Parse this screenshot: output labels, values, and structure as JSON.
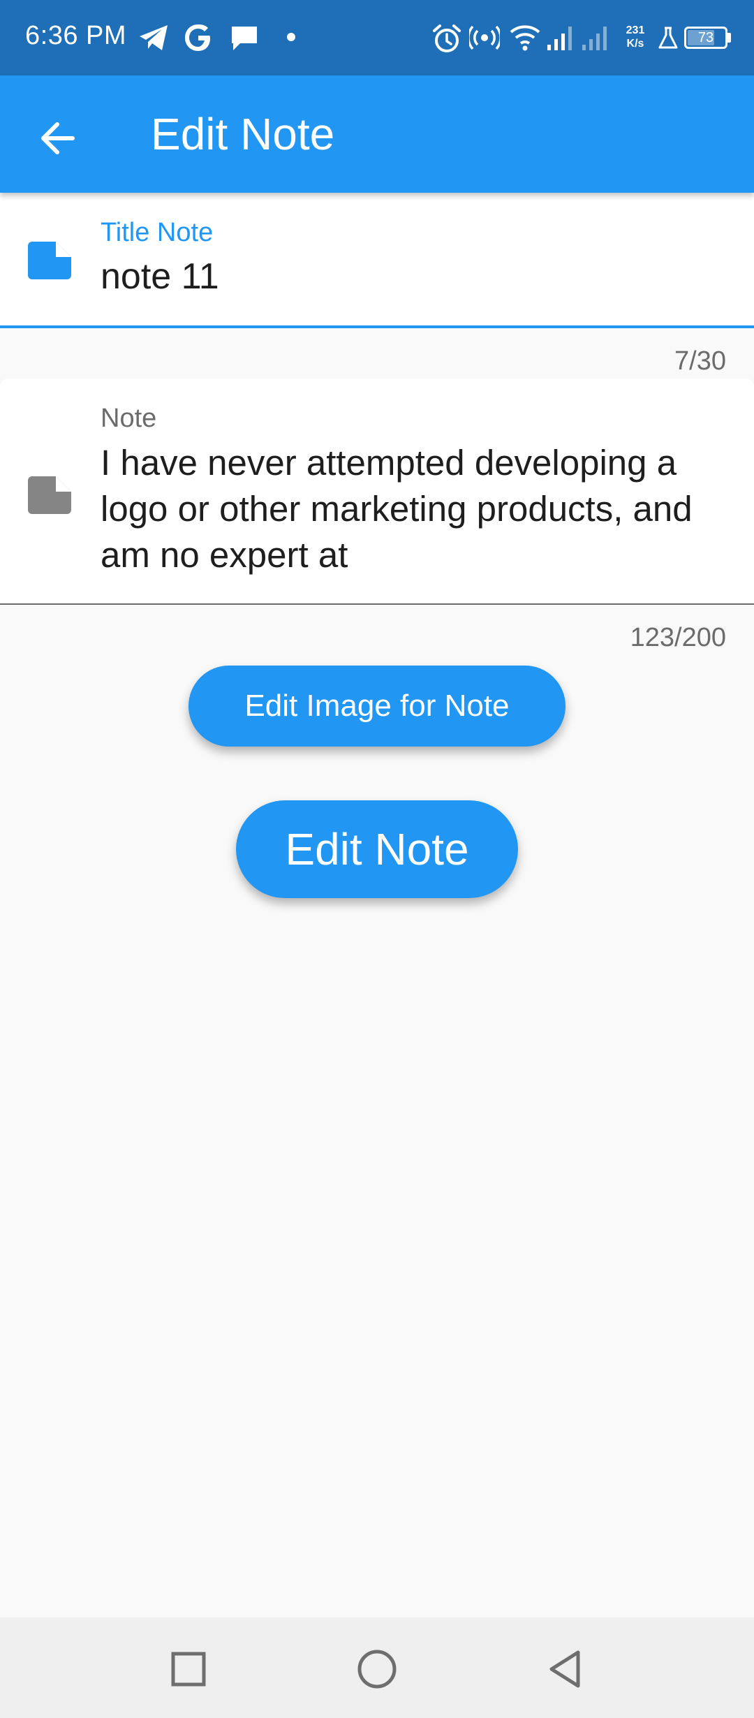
{
  "status_bar": {
    "time": "6:36 PM",
    "speed_value": "231",
    "speed_unit": "K/s",
    "battery_level": "73",
    "icons": [
      "telegram-icon",
      "google-icon",
      "message-icon",
      "dot-icon",
      "alarm-icon",
      "hotspot-icon",
      "wifi-icon",
      "signal-icon",
      "signal-icon",
      "flask-icon",
      "battery-icon"
    ],
    "color": "#1e6fb8"
  },
  "app_bar": {
    "title": "Edit Note",
    "back_icon": "arrow-left-icon",
    "color": "#2196f3"
  },
  "title_field": {
    "label": "Title Note",
    "value": "note 11",
    "counter": "7/30",
    "icon": "note-icon",
    "accent": "#2196f3"
  },
  "note_field": {
    "label": "Note",
    "value": "I have never attempted developing a logo or other marketing products, and am no expert at",
    "counter": "123/200",
    "icon": "note-icon",
    "icon_color": "#858585"
  },
  "buttons": {
    "edit_image": "Edit Image for Note",
    "edit_note": "Edit Note"
  },
  "nav_bar": {
    "icons": [
      "recents-square-icon",
      "home-circle-icon",
      "back-triangle-icon"
    ]
  }
}
